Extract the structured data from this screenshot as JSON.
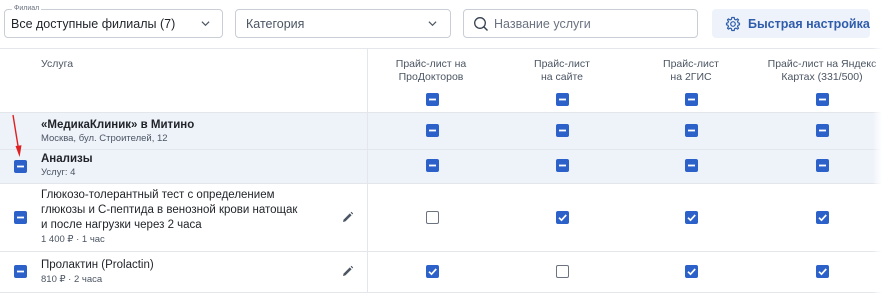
{
  "filters": {
    "branch_label": "Филиал",
    "branch_value": "Все доступные филиалы (7)",
    "category_value": "Категория",
    "search_placeholder": "Название услуги",
    "quick_setup_label": "Быстрая настройка"
  },
  "table": {
    "service_header": "Услуга",
    "columns": [
      {
        "line1": "Прайс-лист на",
        "line2": "ПроДокторов"
      },
      {
        "line1": "Прайс-лист",
        "line2": "на сайте"
      },
      {
        "line1": "Прайс-лист",
        "line2": "на 2ГИС"
      },
      {
        "line1": "Прайс-лист на Яндекс",
        "line2": "Картах (331/500)"
      }
    ],
    "clinic": {
      "name": "«МедикаКлиник» в Митино",
      "address": "Москва, бул. Строителей, 12"
    },
    "category": {
      "name": "Анализы",
      "count": "Услуг: 4"
    },
    "services": [
      {
        "name_lines": [
          "Глюкозо-толерантный тест с определением",
          "глюкозы и С-пептида в венозной крови натощак",
          "и после нагрузки через 2 часа"
        ],
        "meta": "1 400 ₽ · 1 час",
        "states": [
          "unchecked",
          "checked",
          "checked",
          "checked"
        ]
      },
      {
        "name_lines": [
          "Пролактин (Prolactin)"
        ],
        "meta": "810 ₽ · 2 часа",
        "states": [
          "checked",
          "unchecked",
          "checked",
          "checked"
        ]
      }
    ]
  },
  "colors": {
    "accent": "#2b61c8",
    "row_highlight": "#eef2f9",
    "annotation_arrow": "#e02020"
  }
}
